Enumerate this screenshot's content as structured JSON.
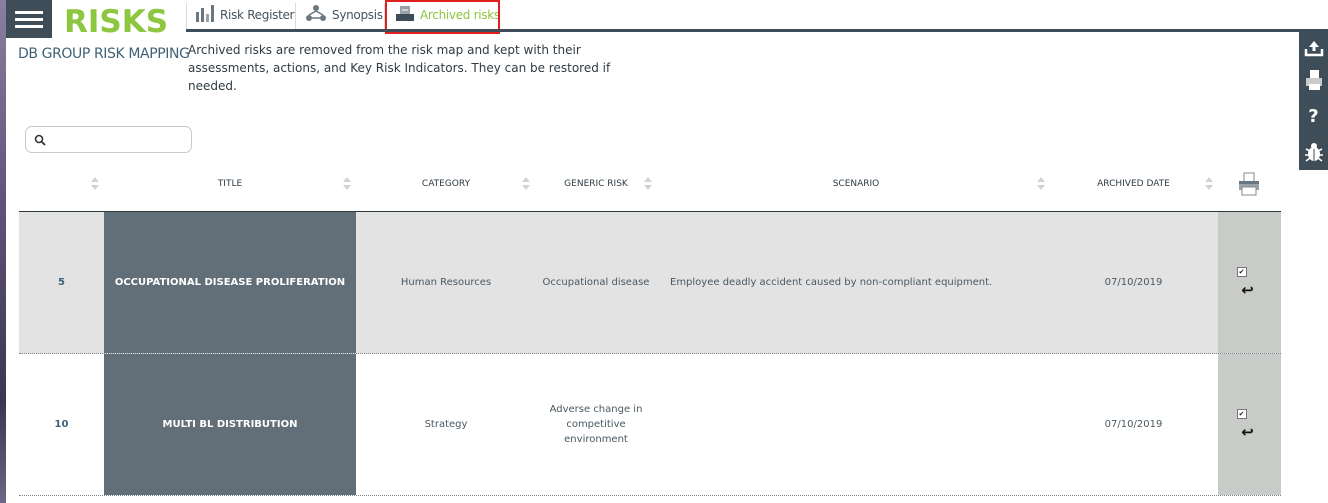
{
  "app": {
    "title": "RISKS",
    "subtitle": "DB GROUP RISK MAPPING",
    "menu_icon": "hamburger-menu-icon"
  },
  "tabs": [
    {
      "label": "Risk Register",
      "icon": "bar-chart-icon",
      "active": false
    },
    {
      "label": "Synopsis",
      "icon": "network-icon",
      "active": false
    },
    {
      "label": "Archived risks",
      "icon": "archive-box-icon",
      "active": true
    }
  ],
  "description": "Archived risks are removed from the risk map and kept with their assessments, actions, and Key Risk Indicators. They can be restored if needed.",
  "search": {
    "placeholder": "",
    "value": "",
    "icon": "search-icon"
  },
  "sidebar_tools": [
    "upload-icon",
    "print-icon",
    "help-icon",
    "bug-icon"
  ],
  "table": {
    "columns": [
      "",
      "TITLE",
      "CATEGORY",
      "GENERIC RISK",
      "SCENARIO",
      "ARCHIVED DATE"
    ],
    "print_icon": "printer-icon",
    "rows": [
      {
        "id": "5",
        "title": "OCCUPATIONAL DISEASE PROLIFERATION",
        "category": "Human Resources",
        "generic_risk": "Occupational disease",
        "scenario": "Employee deadly accident caused by non-compliant equipment.",
        "archived_date": "07/10/2019",
        "checked": true
      },
      {
        "id": "10",
        "title": "MULTI BL DISTRIBUTION",
        "category": "Strategy",
        "generic_risk": "Adverse change in competitive environment",
        "scenario": "",
        "archived_date": "07/10/2019",
        "checked": true
      }
    ]
  },
  "colors": {
    "accent_green": "#8dc63f",
    "dark_slate": "#3e4d57",
    "title_cell": "#636f78",
    "highlight_outline": "#e0201e"
  }
}
